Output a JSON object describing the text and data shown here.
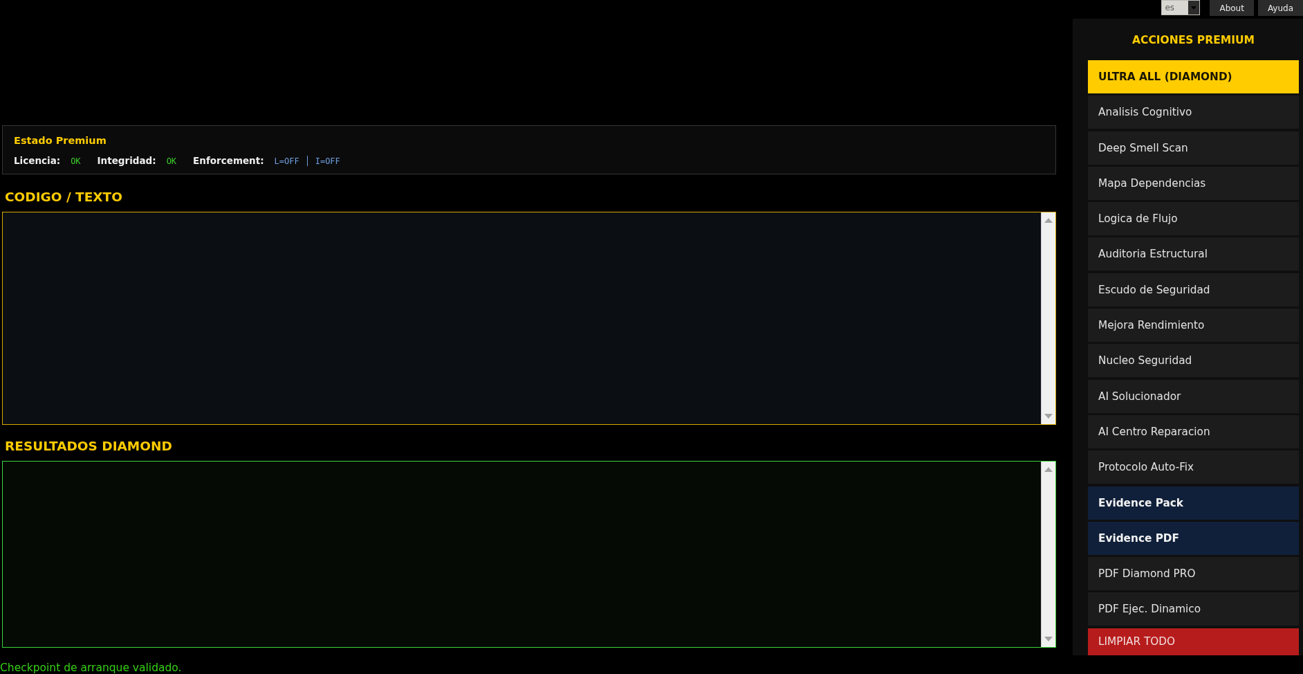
{
  "top_bar": {
    "language_select": {
      "value": "es"
    },
    "buttons": [
      "About",
      "Ayuda"
    ]
  },
  "status_panel": {
    "title": "Estado Premium",
    "items": [
      {
        "label": "Licencia:",
        "kind": "status",
        "values": [
          "OK"
        ]
      },
      {
        "label": "Integridad:",
        "kind": "status",
        "values": [
          "OK"
        ]
      },
      {
        "label": "Enforcement:",
        "kind": "flags",
        "values": [
          "L=OFF",
          "I=OFF"
        ]
      }
    ]
  },
  "code_panel": {
    "title": "CODIGO / TEXTO"
  },
  "results_panel": {
    "title": "RESULTADOS DIAMOND"
  },
  "status_message": "Checkpoint de arranque validado.",
  "sidebar": {
    "title": "ACCIONES PREMIUM",
    "actions": [
      {
        "label": "ULTRA ALL (DIAMOND)",
        "kind": "primary"
      },
      {
        "label": "Analisis Cognitivo",
        "kind": "default"
      },
      {
        "label": "Deep Smell Scan",
        "kind": "default"
      },
      {
        "label": "Mapa Dependencias",
        "kind": "default"
      },
      {
        "label": "Logica de Flujo",
        "kind": "default"
      },
      {
        "label": "Auditoria Estructural",
        "kind": "default"
      },
      {
        "label": "Escudo de Seguridad",
        "kind": "default"
      },
      {
        "label": "Mejora Rendimiento",
        "kind": "default"
      },
      {
        "label": "Nucleo Seguridad",
        "kind": "default"
      },
      {
        "label": "AI Solucionador",
        "kind": "default"
      },
      {
        "label": "AI Centro Reparacion",
        "kind": "default"
      },
      {
        "label": "Protocolo Auto-Fix",
        "kind": "default"
      },
      {
        "label": "Evidence Pack",
        "kind": "evidence"
      },
      {
        "label": "Evidence PDF",
        "kind": "evidence"
      },
      {
        "label": "PDF Diamond PRO",
        "kind": "default"
      },
      {
        "label": "PDF Ejec. Dinamico",
        "kind": "default"
      },
      {
        "label": "LIMPIAR TODO",
        "kind": "danger"
      }
    ]
  }
}
